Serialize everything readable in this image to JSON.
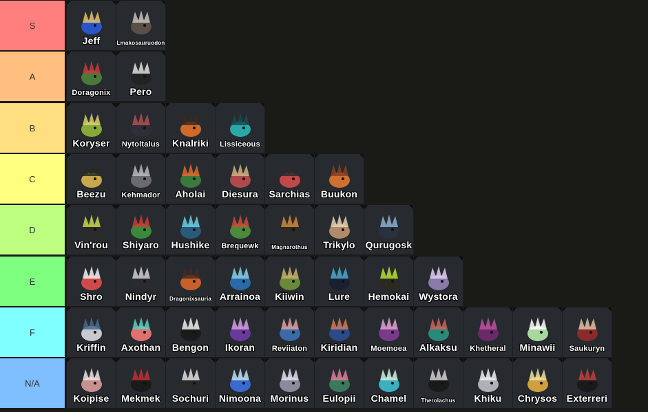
{
  "tiers": [
    {
      "label": "S",
      "color": "#ff7f7f",
      "items": [
        {
          "name": "Jeff",
          "size": "normal",
          "palette": [
            "#2a55c8",
            "#e8c36a"
          ]
        },
        {
          "name": "Lmakosauruodon",
          "size": "tiny",
          "palette": [
            "#5a5048",
            "#c9c2b8"
          ]
        }
      ]
    },
    {
      "label": "A",
      "color": "#ffbf7f",
      "items": [
        {
          "name": "Doragonix",
          "size": "small",
          "palette": [
            "#4a7a3a",
            "#c93a3a"
          ]
        },
        {
          "name": "Pero",
          "size": "normal",
          "palette": [
            "#222222",
            "#e0e0e0"
          ]
        }
      ]
    },
    {
      "label": "B",
      "color": "#ffdf7f",
      "items": [
        {
          "name": "Koryser",
          "size": "normal",
          "palette": [
            "#8aa83a",
            "#d8d070"
          ]
        },
        {
          "name": "Nytoltalus",
          "size": "small",
          "palette": [
            "#2e2e38",
            "#b05050"
          ]
        },
        {
          "name": "Knalriki",
          "size": "normal",
          "palette": [
            "#d06a2a",
            "#3a2a20"
          ]
        },
        {
          "name": "Lissiceous",
          "size": "small",
          "palette": [
            "#2aa8a8",
            "#1a4a50"
          ]
        }
      ]
    },
    {
      "label": "C",
      "color": "#ffff7f",
      "items": [
        {
          "name": "Beezu",
          "size": "normal",
          "palette": [
            "#c8a84a",
            "#2a2a20"
          ]
        },
        {
          "name": "Kehmador",
          "size": "small",
          "palette": [
            "#6a6a70",
            "#b8b8c0"
          ]
        },
        {
          "name": "Aholai",
          "size": "normal",
          "palette": [
            "#3a7a3a",
            "#e06a2a"
          ]
        },
        {
          "name": "Diesura",
          "size": "normal",
          "palette": [
            "#b04a4a",
            "#d0b080"
          ]
        },
        {
          "name": "Sarchias",
          "size": "normal",
          "palette": [
            "#c04848",
            "#2a2a2a"
          ]
        },
        {
          "name": "Buukon",
          "size": "normal",
          "palette": [
            "#d07030",
            "#8a4020"
          ]
        }
      ]
    },
    {
      "label": "D",
      "color": "#bfff7f",
      "items": [
        {
          "name": "Vin'rou",
          "size": "normal",
          "palette": [
            "#2a2a28",
            "#c8d84a"
          ]
        },
        {
          "name": "Shiyaro",
          "size": "normal",
          "palette": [
            "#3a8a3a",
            "#d03a3a"
          ]
        },
        {
          "name": "Hushike",
          "size": "normal",
          "palette": [
            "#2a5a7a",
            "#6ad0e0"
          ]
        },
        {
          "name": "Brequewk",
          "size": "small",
          "palette": [
            "#4a8a3a",
            "#d04a3a"
          ]
        },
        {
          "name": "Magnarothus",
          "size": "tiny",
          "palette": [
            "#2a2a2a",
            "#d08a3a"
          ]
        },
        {
          "name": "Trikylo",
          "size": "normal",
          "palette": [
            "#b08a6a",
            "#e8d0b0"
          ]
        },
        {
          "name": "Qurugosk",
          "size": "normal",
          "palette": [
            "#2a3040",
            "#8ab0d0"
          ]
        }
      ]
    },
    {
      "label": "E",
      "color": "#7fff7f",
      "items": [
        {
          "name": "Shro",
          "size": "normal",
          "palette": [
            "#d04a4a",
            "#f0f0f0"
          ]
        },
        {
          "name": "Nindyr",
          "size": "normal",
          "palette": [
            "#2a2a30",
            "#d0d0d0"
          ]
        },
        {
          "name": "Dragonixsauria",
          "size": "tiny",
          "palette": [
            "#c8602a",
            "#4a2a20"
          ]
        },
        {
          "name": "Arrainoa",
          "size": "normal",
          "palette": [
            "#2a6aa8",
            "#8ad0e8"
          ]
        },
        {
          "name": "Kiiwin",
          "size": "normal",
          "palette": [
            "#6a8a3a",
            "#c8b070"
          ]
        },
        {
          "name": "Lure",
          "size": "normal",
          "palette": [
            "#1a2030",
            "#4aa8d0"
          ]
        },
        {
          "name": "Hemokai",
          "size": "normal",
          "palette": [
            "#2a2a20",
            "#b8e030"
          ]
        },
        {
          "name": "Wystora",
          "size": "normal",
          "palette": [
            "#8a7aa8",
            "#e0d0f0"
          ]
        }
      ]
    },
    {
      "label": "F",
      "color": "#7fffff",
      "items": [
        {
          "name": "Kriffin",
          "size": "normal",
          "palette": [
            "#c8c8d0",
            "#4a6a8a"
          ]
        },
        {
          "name": "Axothan",
          "size": "normal",
          "palette": [
            "#e07070",
            "#5ad0c0"
          ]
        },
        {
          "name": "Bengon",
          "size": "normal",
          "palette": [
            "#1a1a1a",
            "#f0f0f0"
          ]
        },
        {
          "name": "Ikoran",
          "size": "normal",
          "palette": [
            "#6a3a9a",
            "#d0a0e0"
          ]
        },
        {
          "name": "Reviiaton",
          "size": "small",
          "palette": [
            "#3a6aa8",
            "#e0a0a0"
          ]
        },
        {
          "name": "Kiridian",
          "size": "normal",
          "palette": [
            "#2a4a8a",
            "#d07a5a"
          ]
        },
        {
          "name": "Moemoea",
          "size": "small",
          "palette": [
            "#7a3a8a",
            "#e0a0d0"
          ]
        },
        {
          "name": "Alkaksu",
          "size": "normal",
          "palette": [
            "#2a8a7a",
            "#d0605a"
          ]
        },
        {
          "name": "Khetheral",
          "size": "small",
          "palette": [
            "#6a2a6a",
            "#c050a0"
          ]
        },
        {
          "name": "Minawii",
          "size": "normal",
          "palette": [
            "#a8d8a0",
            "#ffffff"
          ]
        },
        {
          "name": "Saukuryn",
          "size": "small",
          "palette": [
            "#8a2a2a",
            "#e0c0a0"
          ]
        }
      ]
    },
    {
      "label": "N/A",
      "color": "#7fbfff",
      "items": [
        {
          "name": "Koipise",
          "size": "normal",
          "palette": [
            "#c89090",
            "#f0e0e0"
          ]
        },
        {
          "name": "Mekmek",
          "size": "normal",
          "palette": [
            "#1a1a1a",
            "#c03030"
          ]
        },
        {
          "name": "Sochuri",
          "size": "normal",
          "palette": [
            "#2a2a2a",
            "#e0e0e0"
          ]
        },
        {
          "name": "Nimoona",
          "size": "normal",
          "palette": [
            "#3a6ad0",
            "#c0e0f0"
          ]
        },
        {
          "name": "Morinus",
          "size": "normal",
          "palette": [
            "#8a8a9a",
            "#e0e0f0"
          ]
        },
        {
          "name": "Eulopii",
          "size": "normal",
          "palette": [
            "#3a7a5a",
            "#e07a9a"
          ]
        },
        {
          "name": "Chamel",
          "size": "normal",
          "palette": [
            "#3ab0c0",
            "#d0f0e0"
          ]
        },
        {
          "name": "Therolachus",
          "size": "tiny",
          "palette": [
            "#1a1a1a",
            "#d0d0d0"
          ]
        },
        {
          "name": "Khiku",
          "size": "normal",
          "palette": [
            "#b0b0b8",
            "#f0f0f0"
          ]
        },
        {
          "name": "Chrysos",
          "size": "normal",
          "palette": [
            "#d0a040",
            "#f0e0a0"
          ]
        },
        {
          "name": "Exterreri",
          "size": "normal",
          "palette": [
            "#1a1a1a",
            "#c04040"
          ]
        }
      ]
    }
  ]
}
